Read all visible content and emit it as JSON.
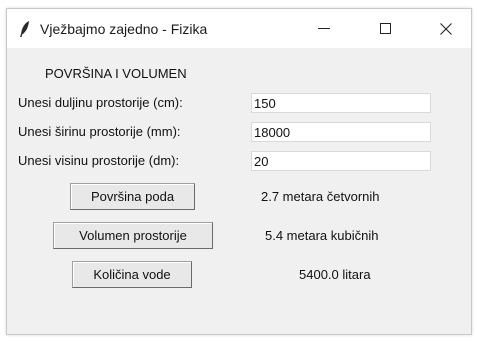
{
  "window": {
    "title": "Vježbajmo zajedno - Fizika",
    "controls": {
      "minimize": "minimize",
      "maximize": "maximize",
      "close": "close"
    }
  },
  "heading": "POVRŠINA I VOLUMEN",
  "fields": [
    {
      "label": "Unesi duljinu prostorije (cm):",
      "value": "150"
    },
    {
      "label": "Unesi širinu prostorije (mm):",
      "value": "18000"
    },
    {
      "label": "Unesi visinu prostorije (dm):",
      "value": "20"
    }
  ],
  "actions": [
    {
      "button": "Površina poda",
      "result": "2.7 metara četvornih"
    },
    {
      "button": "Volumen prostorije",
      "result": "5.4 metara kubičnih"
    },
    {
      "button": "Količina vode",
      "result": "5400.0 litara"
    }
  ]
}
